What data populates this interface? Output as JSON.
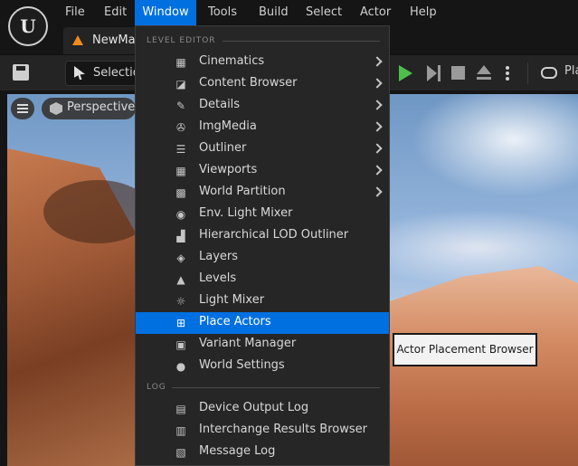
{
  "menubar": {
    "items": [
      "File",
      "Edit",
      "Window",
      "Tools",
      "Build",
      "Select",
      "Actor",
      "Help"
    ],
    "active": "Window"
  },
  "tab": {
    "label": "NewMap"
  },
  "toolbar": {
    "selection_label": "Selection",
    "platforms_label": "Platforms"
  },
  "viewport": {
    "perspective_label": "Perspective"
  },
  "dropdown": {
    "sections": [
      {
        "header": "LEVEL EDITOR",
        "items": [
          {
            "label": "Cinematics",
            "icon": "film-icon",
            "submenu": true
          },
          {
            "label": "Content Browser",
            "icon": "content-browser-icon",
            "submenu": true
          },
          {
            "label": "Details",
            "icon": "pencil-icon",
            "submenu": true
          },
          {
            "label": "ImgMedia",
            "icon": "film-reel-icon",
            "submenu": true
          },
          {
            "label": "Outliner",
            "icon": "outliner-list-icon",
            "submenu": true
          },
          {
            "label": "Viewports",
            "icon": "viewports-grid-icon",
            "submenu": true
          },
          {
            "label": "World Partition",
            "icon": "world-partition-grid-icon",
            "submenu": true
          },
          {
            "label": "Env. Light Mixer",
            "icon": "light-bulb-icon",
            "submenu": false
          },
          {
            "label": "Hierarchical LOD Outliner",
            "icon": "hierarchy-icon",
            "submenu": false
          },
          {
            "label": "Layers",
            "icon": "layers-icon",
            "submenu": false
          },
          {
            "label": "Levels",
            "icon": "levels-icon",
            "submenu": false
          },
          {
            "label": "Light Mixer",
            "icon": "light-rays-icon",
            "submenu": false
          },
          {
            "label": "Place Actors",
            "icon": "place-actors-icon",
            "submenu": false,
            "highlighted": true
          },
          {
            "label": "Variant Manager",
            "icon": "variant-manager-icon",
            "submenu": false
          },
          {
            "label": "World Settings",
            "icon": "globe-icon",
            "submenu": false
          }
        ]
      },
      {
        "header": "LOG",
        "items": [
          {
            "label": "Device Output Log",
            "icon": "terminal-icon",
            "submenu": false
          },
          {
            "label": "Interchange Results Browser",
            "icon": "document-icon",
            "submenu": false
          },
          {
            "label": "Message Log",
            "icon": "message-log-icon",
            "submenu": false
          }
        ]
      }
    ]
  },
  "tooltip": {
    "text": "Actor Placement Browser"
  },
  "colors": {
    "accent": "#0070e0",
    "play": "#4cbf4c",
    "tab_icon": "#f08c1e"
  }
}
